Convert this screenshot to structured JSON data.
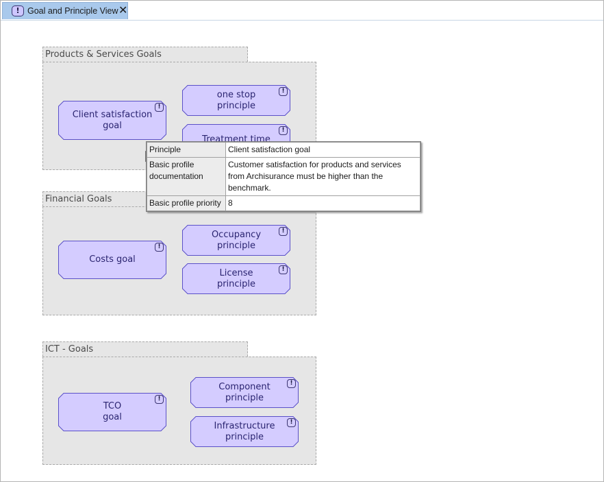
{
  "tab": {
    "icon": "principle-icon",
    "icon_glyph": "!",
    "label": "Goal and Principle View",
    "close_glyph": "✕"
  },
  "colors": {
    "element_fill": "#d4ccff",
    "element_stroke": "#5a50c8",
    "group_fill": "#e6e6e6",
    "tab_active": "#a9c9ec"
  },
  "groups": [
    {
      "title": "Products & Services Goals",
      "elements": [
        {
          "label_lines": [
            "Client satisfaction",
            "goal"
          ],
          "icon": "principle-icon",
          "mark": "!"
        },
        {
          "label_lines": [
            "one stop",
            "principle"
          ],
          "icon": "principle-icon",
          "mark": "!"
        },
        {
          "label_lines": [
            "Treatment time"
          ],
          "icon": "principle-icon",
          "mark": "!"
        }
      ]
    },
    {
      "title": "Financial Goals",
      "elements": [
        {
          "label_lines": [
            "Costs goal"
          ],
          "icon": "principle-icon",
          "mark": "!"
        },
        {
          "label_lines": [
            "Occupancy",
            "principle"
          ],
          "icon": "principle-icon",
          "mark": "!"
        },
        {
          "label_lines": [
            "License",
            "principle"
          ],
          "icon": "principle-icon",
          "mark": "!"
        }
      ]
    },
    {
      "title": "ICT - Goals",
      "elements": [
        {
          "label_lines": [
            "TCO",
            "goal"
          ],
          "icon": "principle-icon",
          "mark": "!"
        },
        {
          "label_lines": [
            "Component",
            "principle"
          ],
          "icon": "principle-icon",
          "mark": "!"
        },
        {
          "label_lines": [
            "Infrastructure",
            "principle"
          ],
          "icon": "principle-icon",
          "mark": "!"
        }
      ]
    }
  ],
  "tooltip": {
    "rows": [
      {
        "key": "Principle",
        "value": "Client satisfaction goal"
      },
      {
        "key": "Basic profile documentation",
        "value": "Customer satisfaction for products and services from Archisurance must be higher than the benchmark."
      },
      {
        "key": "Basic profile priority",
        "value": "8"
      }
    ]
  }
}
